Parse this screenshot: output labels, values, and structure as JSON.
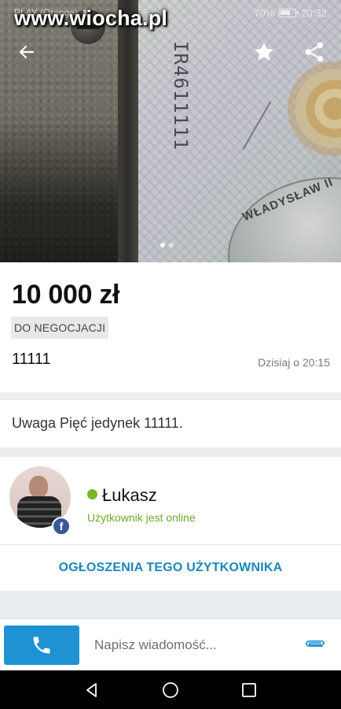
{
  "status_bar": {
    "carrier": "PLAY (Orange)",
    "battery_percent": "70%",
    "battery_level": 0.7,
    "time": "20:32"
  },
  "watermark": "www.wiocha.pl",
  "gallery": {
    "image_count": 2,
    "active_index": 0,
    "banknote_serial": "IR4611111",
    "banknote_text": "WŁADYSŁAW II"
  },
  "listing": {
    "price": "10 000 zł",
    "negotiable_badge": "DO NEGOCJACJI",
    "title": "11111",
    "posted_date": "Dzisiaj o 20:15",
    "description": "Uwaga Pięć jedynek 11111."
  },
  "seller": {
    "name": "Łukasz",
    "status": "Użytkownik jest online",
    "badge": "f",
    "user_ads_link": "OGŁOSZENIA TEGO UŻYTKOWNIKA"
  },
  "message_bar": {
    "placeholder": "Napisz wiadomość..."
  },
  "icons": {
    "back": "arrow-left-icon",
    "favorite": "star-icon",
    "share": "share-icon",
    "call": "phone-icon",
    "attach": "paperclip-icon",
    "nav_back": "triangle-back-icon",
    "nav_home": "circle-home-icon",
    "nav_recent": "square-recent-icon"
  },
  "colors": {
    "accent": "#1f92d3",
    "link": "#1c86b8",
    "online": "#7cb527",
    "facebook": "#3b5998"
  }
}
